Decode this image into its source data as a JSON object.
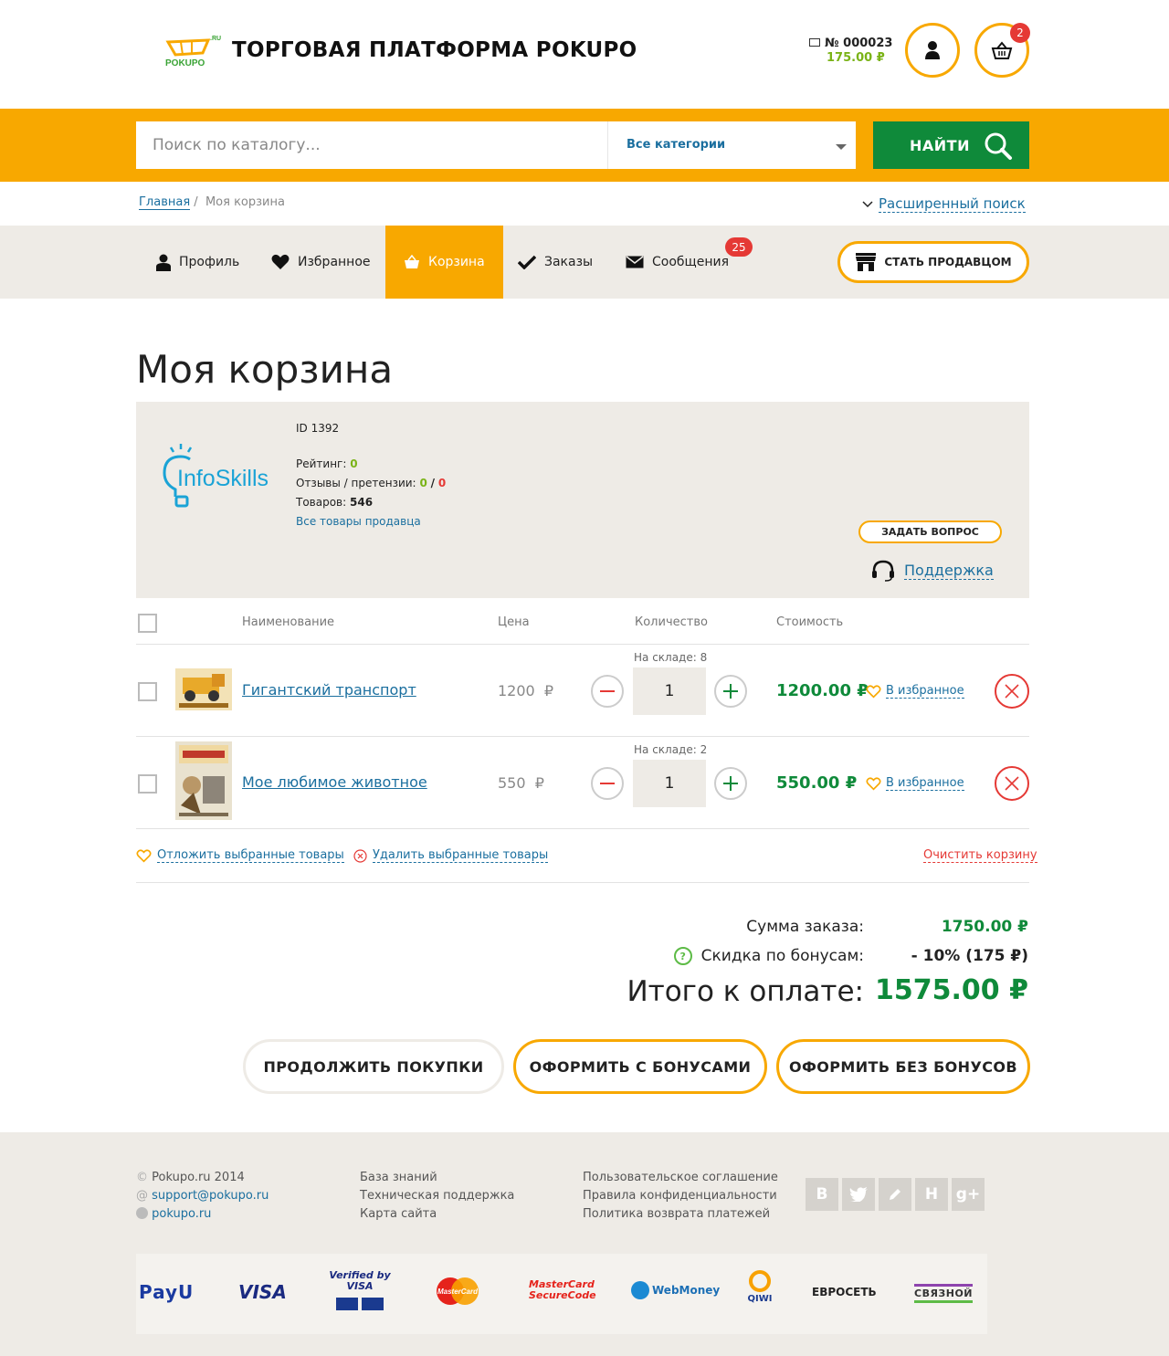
{
  "header": {
    "site_title": "ТОРГОВАЯ ПЛАТФОРМА POKUPO",
    "logo_text": "POKUPO",
    "logo_suffix": ".RU",
    "order_number": "№ 000023",
    "order_sum": "175.00 ₽",
    "cart_count": "2"
  },
  "search": {
    "placeholder": "Поиск по каталогу...",
    "category": "Все категории",
    "button_label": "НАЙТИ"
  },
  "breadcrumb": {
    "home": "Главная",
    "separator": "/",
    "current": "Моя корзина"
  },
  "advanced_search": "Расширенный поиск",
  "nav": {
    "profile": "Профиль",
    "favorites": "Избранное",
    "cart": "Корзина",
    "orders": "Заказы",
    "messages": "Сообщения",
    "messages_count": "25",
    "become_seller": "СТАТЬ ПРОДАВЦОМ"
  },
  "page_title": "Моя корзина",
  "seller": {
    "logo_name": "InfoSkills",
    "id": "ID 1392",
    "rating_label": "Рейтинг:",
    "rating": "0",
    "reviews_label": "Отзывы / претензии:",
    "reviews": "0",
    "reviews_sep": "/",
    "claims": "0",
    "goods_label": "Товаров:",
    "goods": "546",
    "all_goods_link": "Все товары продавца",
    "ask_button": "ЗАДАТЬ ВОПРОС",
    "support_link": "Поддержка"
  },
  "table": {
    "headers": {
      "name": "Наименование",
      "price": "Цена",
      "quantity": "Количество",
      "cost": "Стоимость"
    },
    "rows": [
      {
        "name": "Гигантский транспорт",
        "price": "1200",
        "currency": "₽",
        "stock": "На складе: 8",
        "quantity": "1",
        "cost": "1200.00 ₽",
        "fav": "В избранное"
      },
      {
        "name": "Мое любимое животное",
        "price": "550",
        "currency": "₽",
        "stock": "На складе: 2",
        "quantity": "1",
        "cost": "550.00 ₽",
        "fav": "В избранное"
      }
    ]
  },
  "actions": {
    "postpone": "Отложить выбранные товары",
    "delete": "Удалить выбранные товары",
    "clear": "Очистить корзину"
  },
  "totals": {
    "sum_label": "Сумма заказа:",
    "sum_value": "1750.00 ₽",
    "discount_label": "Скидка по бонусам:",
    "discount_value": "- 10% (175 ₽)",
    "total_label": "Итого к оплате:",
    "total_value": "1575.00 ₽"
  },
  "buttons": {
    "continue": "ПРОДОЛЖИТЬ ПОКУПКИ",
    "checkout_bonus": "ОФОРМИТЬ С БОНУСАМИ",
    "checkout_no_bonus": "ОФОРМИТЬ БЕЗ БОНУСОВ"
  },
  "footer": {
    "copyright": "Pokupo.ru 2014",
    "email": "support@pokupo.ru",
    "skype": "pokupo.ru",
    "col2": [
      "База знаний",
      "Техническая поддержка",
      "Карта сайта"
    ],
    "col3": [
      "Пользовательское соглашение",
      "Правила конфиденциальности",
      "Политика возврата платежей"
    ],
    "social": [
      "В",
      "twitter-icon",
      "pencil-icon",
      "Н",
      "g+"
    ],
    "payments": [
      "PayU",
      "VISA",
      "Verified by VISA",
      "MasterCard",
      "MasterCard SecureCode",
      "WebMoney",
      "QIWI",
      "ЕВРОСЕТЬ",
      "СВЯЗНОЙ"
    ]
  },
  "colors": {
    "accent": "#f8a800",
    "green": "#0f8a3a",
    "link": "#1b6f9f",
    "danger": "#e53935",
    "panel": "#eeebe6"
  }
}
